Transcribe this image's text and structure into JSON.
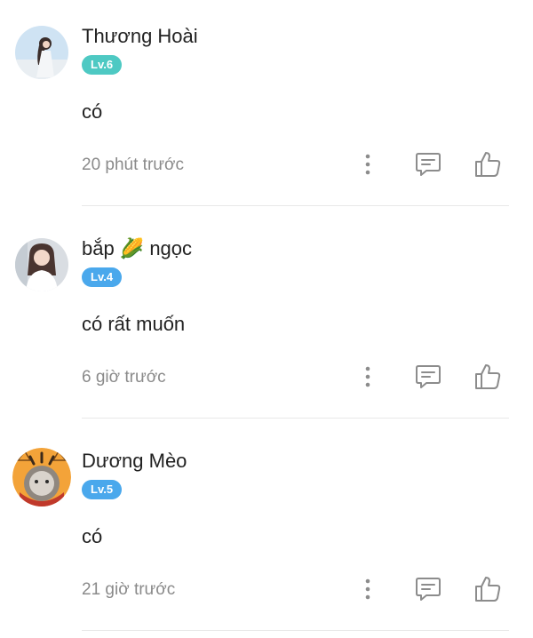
{
  "colors": {
    "badge_lv6": "#4ec9c3",
    "badge_lv4": "#4aa8ec",
    "badge_lv5": "#4aa8ec",
    "meta_text": "#8a8a8a",
    "icon": "#8c8c8c"
  },
  "comments": [
    {
      "username": "Thương Hoài",
      "level": "Lv.6",
      "text": "có",
      "time": "20 phút trước",
      "icons": [
        "more-vertical-icon",
        "reply-icon",
        "thumbs-up-icon"
      ]
    },
    {
      "username": "bắp 🌽 ngọc",
      "level": "Lv.4",
      "text": "có rất muốn",
      "time": "6 giờ trước",
      "icons": [
        "more-vertical-icon",
        "reply-icon",
        "thumbs-up-icon"
      ]
    },
    {
      "username": "Dương Mèo",
      "level": "Lv.5",
      "text": "có",
      "time": "21 giờ trước",
      "icons": [
        "more-vertical-icon",
        "reply-icon",
        "thumbs-up-icon"
      ]
    }
  ]
}
